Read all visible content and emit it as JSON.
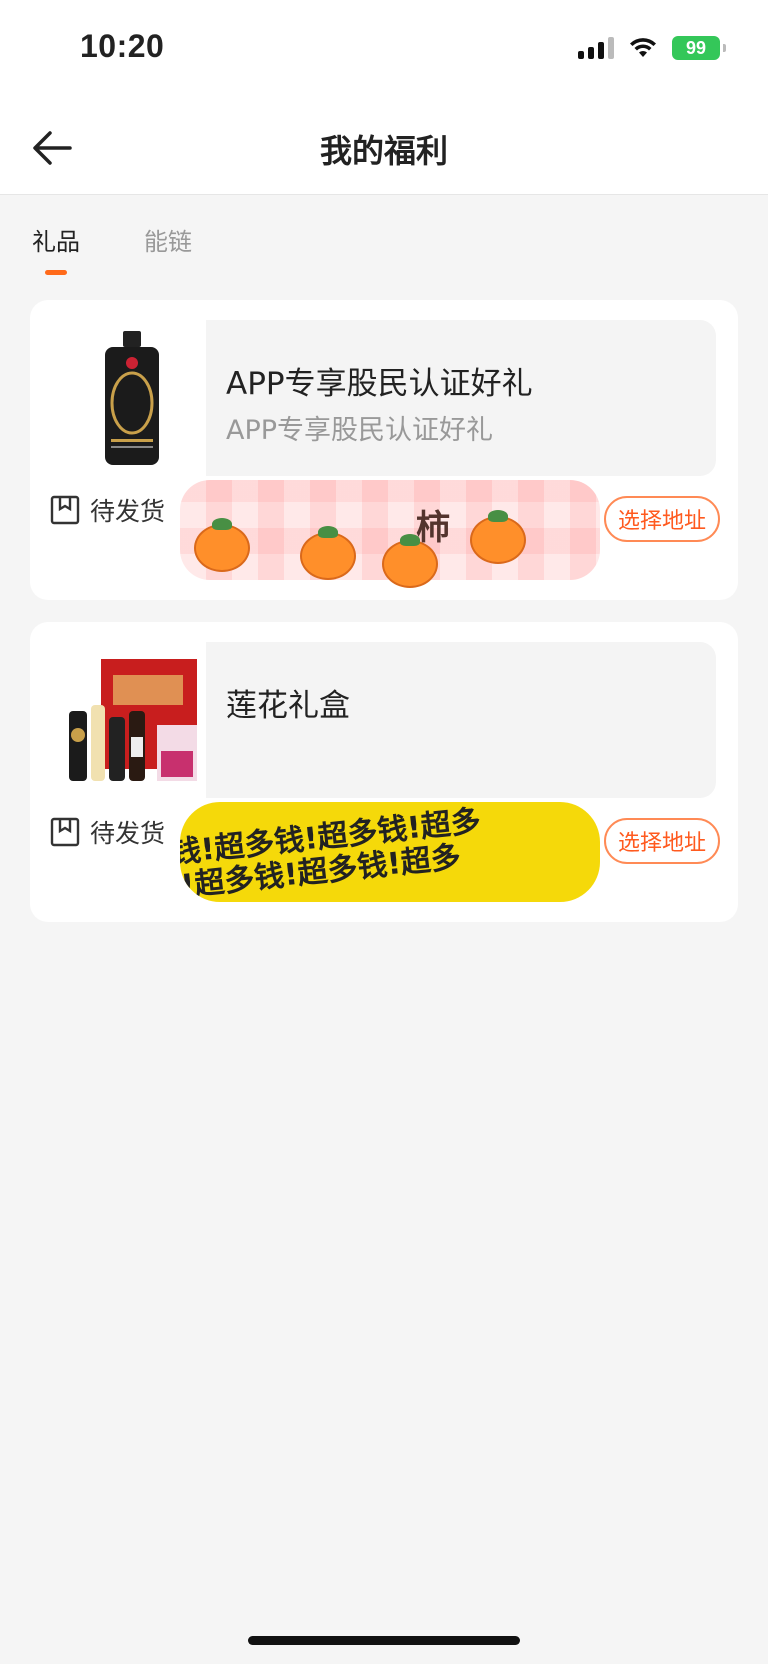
{
  "status_bar": {
    "time": "10:20",
    "battery": "99"
  },
  "nav": {
    "title": "我的福利"
  },
  "tabs": [
    {
      "label": "礼品",
      "active": true
    },
    {
      "label": "能链",
      "active": false
    }
  ],
  "cards": [
    {
      "title": "APP专享股民认证好礼",
      "subtitle": "APP专享股民认证好礼",
      "status": "待发货",
      "button": "选择地址",
      "sticker_text": "柿"
    },
    {
      "title": "莲花礼盒",
      "subtitle": "",
      "status": "待发货",
      "button": "选择地址",
      "sticker_text": "钱!超多钱!超多钱!超多"
    }
  ],
  "colors": {
    "accent": "#ff6a1a",
    "battery": "#34c759",
    "sticker_yellow": "#f5d90a"
  }
}
